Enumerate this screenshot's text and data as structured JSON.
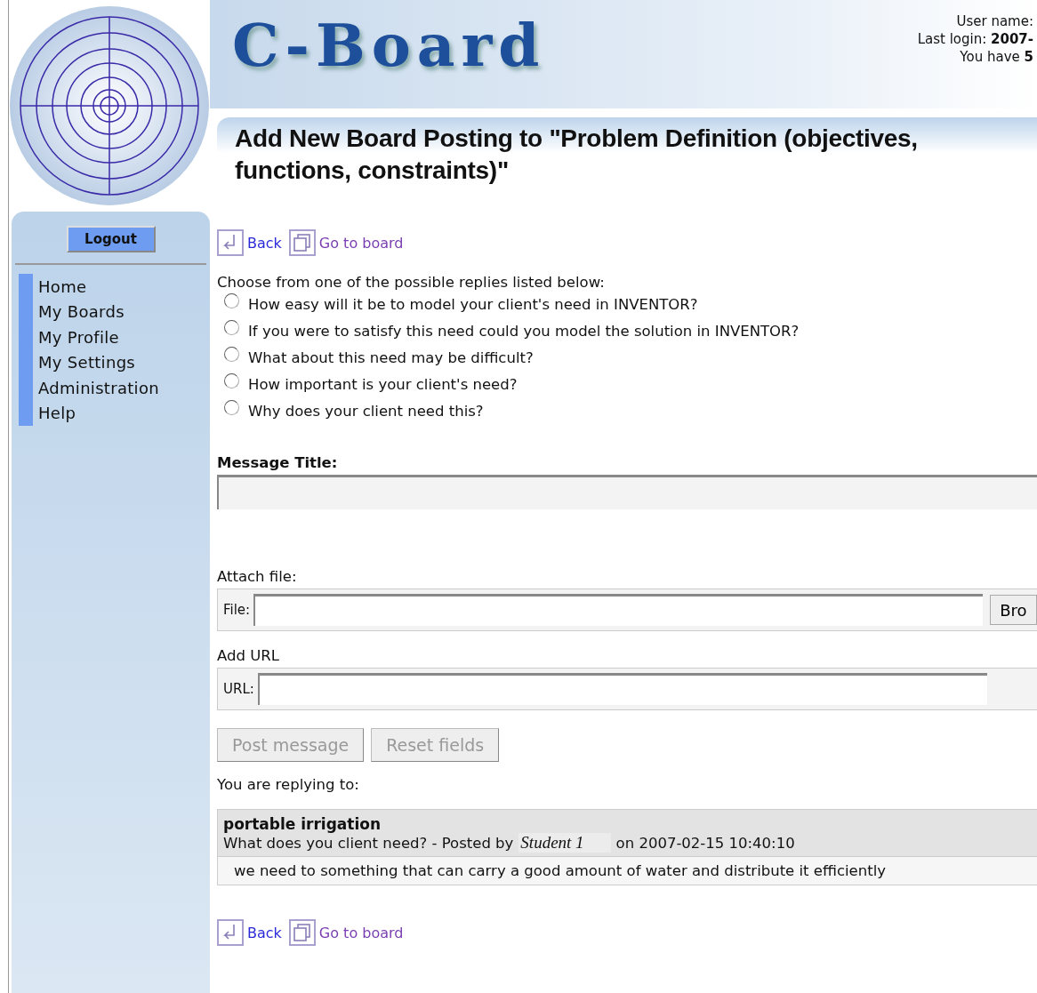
{
  "header": {
    "logo_text": "C-Board",
    "user_info": [
      "User name:",
      "Last login: **2007-**",
      "You have **5**"
    ]
  },
  "page_title": "Add New Board Posting to \"Problem Definition (objectives, functions, constraints)\"",
  "sidebar": {
    "logout": "Logout",
    "items": [
      {
        "label": "Home"
      },
      {
        "label": "My Boards"
      },
      {
        "label": "My Profile"
      },
      {
        "label": "My Settings"
      },
      {
        "label": "Administration"
      },
      {
        "label": "Help"
      }
    ]
  },
  "top_nav": {
    "back": "Back",
    "go_to_board": "Go to board"
  },
  "replies": {
    "prompt": "Choose from one of the possible replies listed below:",
    "options": [
      {
        "label": "How easy will it be to model your client's need in INVENTOR?",
        "selected": false
      },
      {
        "label": "If you were to satisfy this need could you model the solution in INVENTOR?",
        "selected": false
      },
      {
        "label": "What about this need may be difficult?",
        "selected": false
      },
      {
        "label": "How important is your client's need?",
        "selected": false
      },
      {
        "label": "Why does your client need this?",
        "selected": false
      }
    ]
  },
  "message_title": {
    "label": "Message Title:"
  },
  "attach": {
    "label": "Attach file:",
    "field_label": "File:",
    "browse": "Bro"
  },
  "url": {
    "label": "Add URL",
    "field_label": "URL:"
  },
  "buttons": [
    {
      "label": "Post message",
      "disabled": true
    },
    {
      "label": "Reset fields",
      "disabled": true
    }
  ],
  "replying": {
    "label": "You are replying to:",
    "title": "portable irrigation",
    "meta_prefix": "What does you client need? - Posted by",
    "author": "Student 1",
    "meta_suffix": "on 2007-02-15 10:40:10",
    "body": "we need to something that can carry a good amount of water and distribute it efficiently"
  },
  "bottom_nav": {
    "back": "Back",
    "go_to_board": "Go to board"
  }
}
